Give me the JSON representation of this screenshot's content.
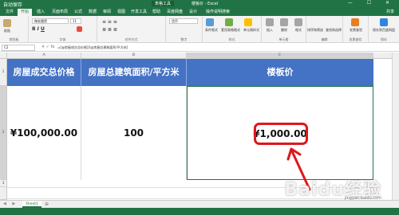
{
  "window": {
    "title": "楼板价 - Excel",
    "tools_label": "表格工具",
    "left_label": "自动保存",
    "controls": "— ☐ ✕"
  },
  "ribbon": {
    "tabs": [
      "文件",
      "开始",
      "插入",
      "页面布局",
      "公式",
      "数据",
      "审阅",
      "视图",
      "开发工具",
      "帮助",
      "百度网盘",
      "设计"
    ],
    "active_tab": 1,
    "search_placeholder": "操作说明搜索",
    "share": "共享",
    "groups": [
      "剪贴板",
      "字体",
      "对齐方式",
      "数字",
      "样式",
      "单元格",
      "编辑",
      "发票查验",
      "保存"
    ],
    "font_name": "微软雅黑",
    "font_size": "11",
    "number_format": "货币",
    "buttons": {
      "paste": "粘贴",
      "conditional_format": "条件格式",
      "format_as_table": "套用表格格式",
      "cell_styles": "单元格样式",
      "insert": "插入",
      "delete": "删除",
      "format": "格式",
      "sort_filter": "排序和筛选",
      "find_select": "查找和选择",
      "invoice": "发票查验",
      "save_to_baidu": "保存到百度网盘"
    }
  },
  "formula_bar": {
    "name_box": "C2",
    "fx": "✕ ✓ fx",
    "formula": "=[@房屋成交总价格]/[@房屋总建筑面积/平方米]"
  },
  "sheet": {
    "columns": [
      "A",
      "B",
      "C"
    ],
    "selected_column": "C",
    "rows": [
      "1",
      "2",
      "3"
    ],
    "headers": [
      "房屋成交总价格",
      "房屋总建筑面积/平方米",
      "楼板价"
    ],
    "values": [
      "¥100,000.00",
      "100",
      "¥1,000.00"
    ],
    "tab_name": "Sheet1",
    "add_sheet": "⊕",
    "nav": "◀ ▶"
  },
  "annotation": {
    "color": "#e0161d"
  },
  "watermark": {
    "text": "Baidu经验",
    "sub": "jingyan.baidu.com"
  }
}
